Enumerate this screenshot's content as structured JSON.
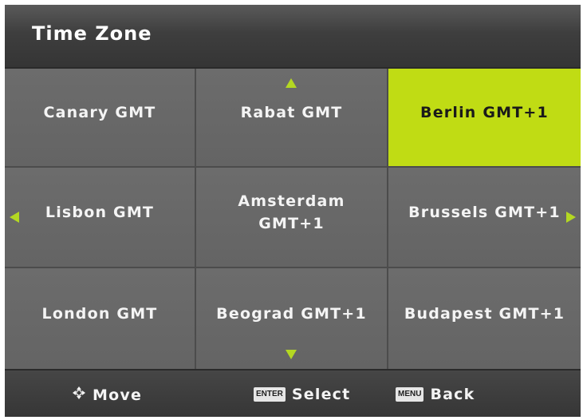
{
  "header": {
    "title": "Time Zone"
  },
  "grid": {
    "selected_index": 2,
    "cells": [
      {
        "label": "Canary GMT"
      },
      {
        "label": "Rabat GMT"
      },
      {
        "label": "Berlin GMT+1"
      },
      {
        "label": "Lisbon GMT"
      },
      {
        "label": "Amsterdam\nGMT+1"
      },
      {
        "label": "Brussels GMT+1"
      },
      {
        "label": "London GMT"
      },
      {
        "label": "Beograd GMT+1"
      },
      {
        "label": "Budapest GMT+1"
      }
    ],
    "arrows": {
      "up": "arrow-up-icon",
      "down": "arrow-down-icon",
      "left": "arrow-left-icon",
      "right": "arrow-right-icon"
    }
  },
  "footer": {
    "move": {
      "icon": "dpad-icon",
      "label": "Move"
    },
    "select": {
      "key": "ENTER",
      "label": "Select"
    },
    "back": {
      "key": "MENU",
      "label": "Back"
    }
  },
  "colors": {
    "background": "#3a3a3a",
    "cell": "#666666",
    "selected": "#c0dc14",
    "arrow": "#b4d822",
    "text": "#f4f4f4",
    "selected_text": "#1a1a1a"
  }
}
